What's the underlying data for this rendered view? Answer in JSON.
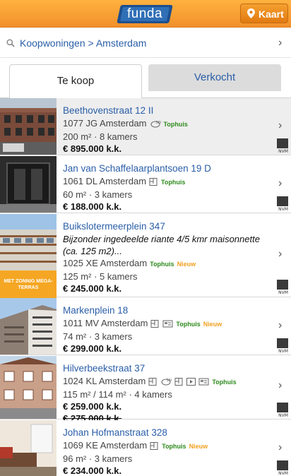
{
  "header": {
    "logo_text": "funda",
    "map_button": "Kaart"
  },
  "breadcrumb": {
    "text": "Koopwoningen > Amsterdam"
  },
  "tabs": {
    "for_sale": "Te koop",
    "sold": "Verkocht"
  },
  "listings": [
    {
      "street": "Beethovenstraat 12 II",
      "postal": "1077 JG Amsterdam",
      "icon_label": "360",
      "size": "200 m² · 8 kamers",
      "price": "€ 895.000 k.k.",
      "badge_top": "Tophuis",
      "badge_new": ""
    },
    {
      "street": "Jan van Schaffelaarplantsoen 19 D",
      "postal": "1061 DL Amsterdam",
      "size": "60 m² · 3 kamers",
      "price": "€ 188.000 k.k.",
      "badge_top": "Tophuis",
      "badge_new": ""
    },
    {
      "street": "Buikslotermeerplein 347",
      "desc": "Bijzonder ingedeelde riante 4/5 kmr maisonnette (ca. 125 m2)...",
      "postal": "1025 XE Amsterdam",
      "size": "125 m² · 5 kamers",
      "price": "€ 245.000 k.k.",
      "badge_top": "Tophuis",
      "badge_new": "Nieuw",
      "banner": "MET ZONNIG MEGA-TERRAS"
    },
    {
      "street": "Markenplein 18",
      "postal": "1011 MV Amsterdam",
      "size": "74 m² · 3 kamers",
      "price": "€ 299.000 k.k.",
      "badge_top": "Tophuis",
      "badge_new": "Nieuw"
    },
    {
      "street": "Hilverbeekstraat 37",
      "postal": "1024 KL Amsterdam",
      "icon_label": "360",
      "size": "115 m² / 114 m² · 4 kamers",
      "price": "€ 259.000 k.k.",
      "old_price": "€ 275.000 k.k.",
      "badge_top": "Tophuis",
      "badge_new": ""
    },
    {
      "street": "Johan Hofmanstraat 328",
      "postal": "1069 KE Amsterdam",
      "size": "96 m² · 3 kamers",
      "price": "€ 234.000 k.k.",
      "badge_top": "Tophuis",
      "badge_new": "Nieuw"
    }
  ],
  "nvm_label": "NVM"
}
